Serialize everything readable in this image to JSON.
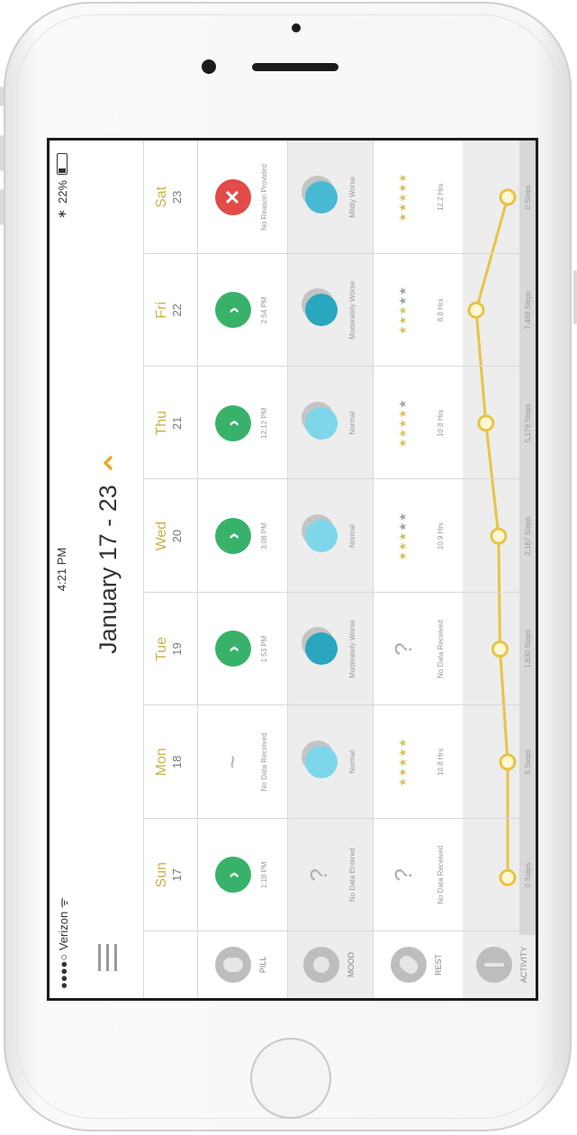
{
  "status_bar": {
    "carrier": "●●●●○ Verizon ᯤ",
    "time": "4:21 PM",
    "bluetooth": "∗",
    "battery": "22%"
  },
  "header": {
    "title": "January 17 - 23",
    "prev_icon": "chevron-up-icon",
    "menu_icon": "hamburger-menu-icon"
  },
  "days": [
    {
      "name": "Sun",
      "num": "17"
    },
    {
      "name": "Mon",
      "num": "18"
    },
    {
      "name": "Tue",
      "num": "19"
    },
    {
      "name": "Wed",
      "num": "20"
    },
    {
      "name": "Thu",
      "num": "21"
    },
    {
      "name": "Fri",
      "num": "22"
    },
    {
      "name": "Sat",
      "num": "23"
    }
  ],
  "rows": {
    "pill": {
      "label": "PILL"
    },
    "mood": {
      "label": "MOOD"
    },
    "rest": {
      "label": "REST"
    },
    "activity": {
      "label": "ACTIVITY"
    }
  },
  "pill": [
    {
      "status": "taken",
      "text": "1:10 PM"
    },
    {
      "status": "none",
      "text": "No Data Received"
    },
    {
      "status": "taken",
      "text": "1:53 PM"
    },
    {
      "status": "taken",
      "text": "3:08 PM"
    },
    {
      "status": "taken",
      "text": "12:12 PM"
    },
    {
      "status": "taken",
      "text": "2:54 PM"
    },
    {
      "status": "missed",
      "text": "No Reason Provided"
    }
  ],
  "mood": [
    {
      "state": "none",
      "text": "No Data Entered"
    },
    {
      "state": "normal",
      "text": "Normal"
    },
    {
      "state": "worse",
      "text": "Moderately Worse"
    },
    {
      "state": "normal",
      "text": "Normal"
    },
    {
      "state": "normal",
      "text": "Normal"
    },
    {
      "state": "worse",
      "text": "Moderately Worse"
    },
    {
      "state": "mild",
      "text": "Mildly Worse"
    }
  ],
  "rest": [
    {
      "stars": null,
      "text": "No Data Received"
    },
    {
      "stars": 5,
      "text": "10.8 Hrs"
    },
    {
      "stars": null,
      "text": "No Data Received"
    },
    {
      "stars": 3,
      "text": "10.9 Hrs"
    },
    {
      "stars": 4,
      "text": "10.8 Hrs"
    },
    {
      "stars": 3,
      "text": "8.8 Hrs"
    },
    {
      "stars": 5,
      "text": "12.2 Hrs"
    }
  ],
  "activity": [
    {
      "steps": 0,
      "text": "0 Steps"
    },
    {
      "steps": 5,
      "text": "5 Steps"
    },
    {
      "steps": 1830,
      "text": "1,830 Steps"
    },
    {
      "steps": 2167,
      "text": "2,167 Steps"
    },
    {
      "steps": 5179,
      "text": "5,179 Steps"
    },
    {
      "steps": 7489,
      "text": "7,489 Steps"
    },
    {
      "steps": 0,
      "text": "0 Steps"
    }
  ],
  "colors": {
    "accent": "#e9c344",
    "green": "#38b26b",
    "red": "#e14b49",
    "mood_light": "#7dd6ea",
    "mood_dark": "#2ba6bf"
  }
}
